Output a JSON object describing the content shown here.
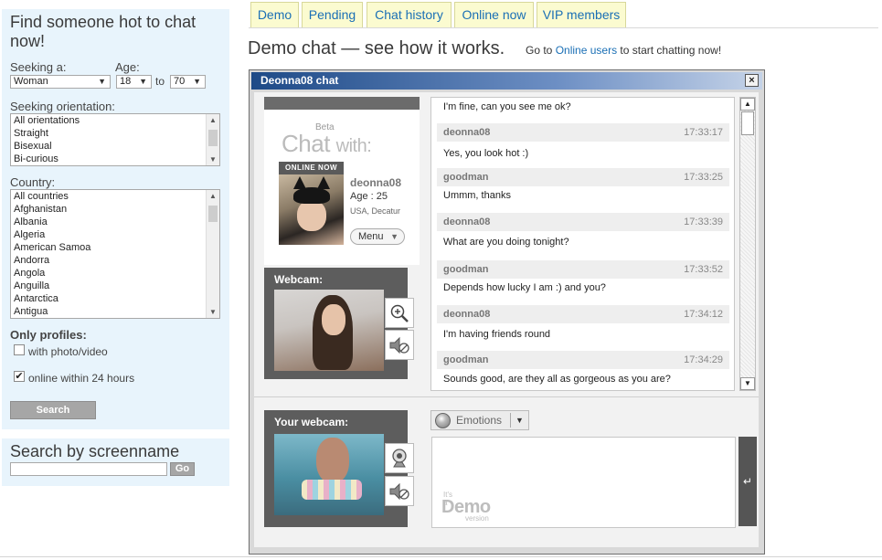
{
  "sidebar": {
    "find_title": "Find someone hot to chat now!",
    "seeking_label": "Seeking a:",
    "seeking_value": "Woman",
    "age_label": "Age:",
    "age_from": "18",
    "age_to_label": "to",
    "age_to": "70",
    "orientation_label": "Seeking orientation:",
    "orientations": [
      "All orientations",
      "Straight",
      "Bisexual",
      "Bi-curious"
    ],
    "country_label": "Country:",
    "countries": [
      "All countries",
      "Afghanistan",
      "Albania",
      "Algeria",
      "American Samoa",
      "Andorra",
      "Angola",
      "Anguilla",
      "Antarctica",
      "Antigua"
    ],
    "only_profiles_label": "Only profiles:",
    "with_photo_label": "with photo/video",
    "with_photo_checked": false,
    "online_label": "online within 24 hours",
    "online_checked": true,
    "search_button": "Search",
    "screenname_title": "Search by screenname",
    "screenname_value": "",
    "go_button": "Go"
  },
  "tabs": [
    "Demo",
    "Pending",
    "Chat history",
    "Online now",
    "VIP members"
  ],
  "headline": "Demo chat — see how it works.",
  "goto": {
    "prefix": "Go to",
    "link": "Online users",
    "suffix": "to start chatting now!"
  },
  "chat": {
    "window_title": "Deonna08 chat",
    "close_label": "×",
    "beta_label": "Beta",
    "chat_with_big": "Chat",
    "chat_with_small": "with:",
    "online_badge": "ONLINE NOW",
    "profile": {
      "name": "deonna08",
      "age": "Age : 25",
      "location": "USA, Decatur"
    },
    "menu_label": "Menu",
    "webcam_label": "Webcam:",
    "your_webcam_label": "Your webcam:",
    "first_line": "I'm fine, can you see me ok?",
    "messages": [
      {
        "who": "deonna08",
        "time": "17:33:17",
        "text": "Yes, you look hot :)"
      },
      {
        "who": "goodman",
        "time": "17:33:25",
        "text": "Ummm, thanks"
      },
      {
        "who": "deonna08",
        "time": "17:33:39",
        "text": "What are you doing tonight?"
      },
      {
        "who": "goodman",
        "time": "17:33:52",
        "text": "Depends how lucky I am :) and you?"
      },
      {
        "who": "deonna08",
        "time": "17:34:12",
        "text": "I'm having friends round"
      },
      {
        "who": "goodman",
        "time": "17:34:29",
        "text": "Sounds good, are they all as gorgeous as you are?"
      }
    ],
    "emotions_label": "Emotions",
    "demo_stamp": {
      "top": "It's a",
      "main": "Demo",
      "bottom": "version"
    },
    "send_glyph": "↵"
  }
}
